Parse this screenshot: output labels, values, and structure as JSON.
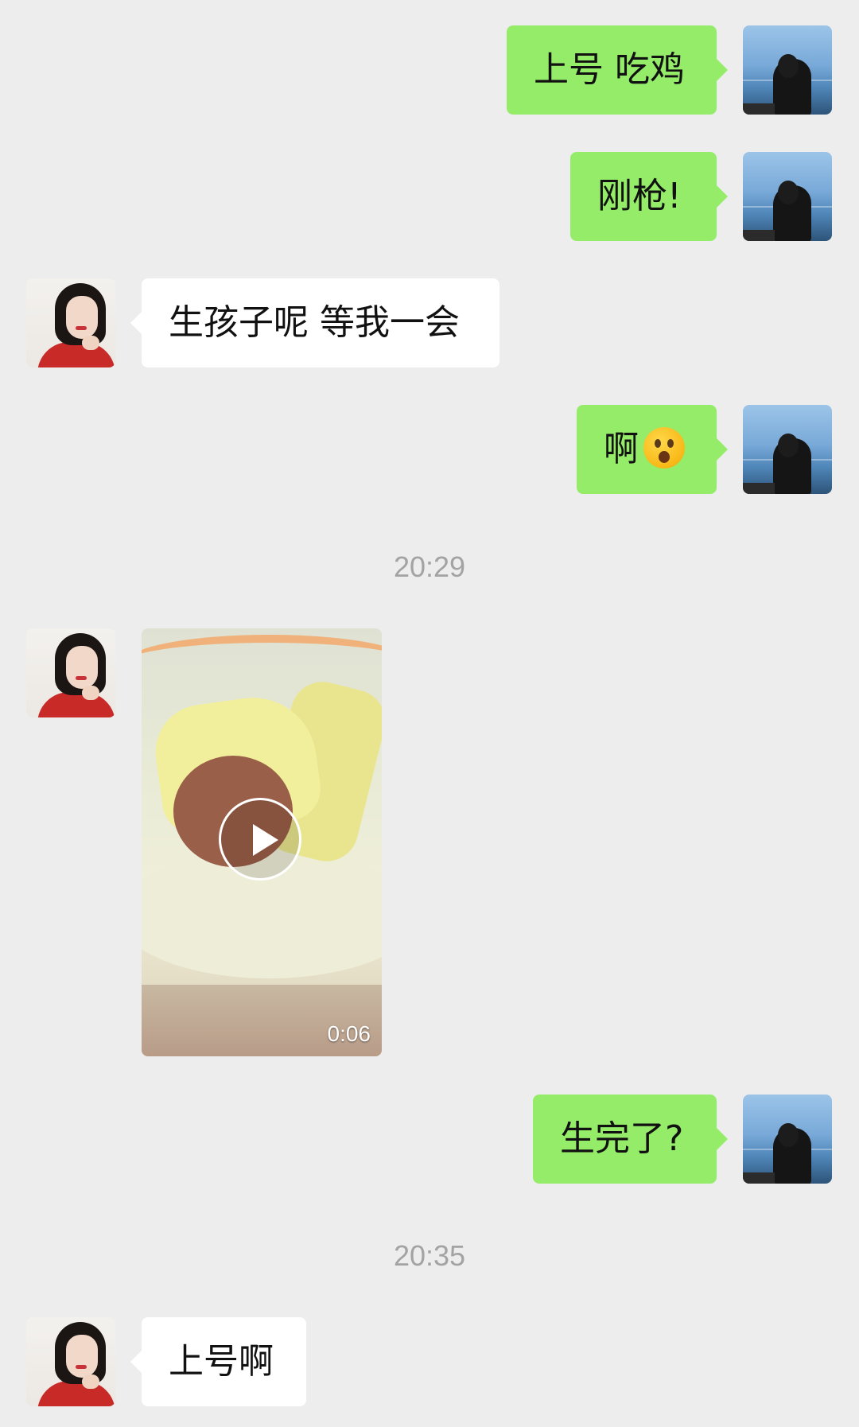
{
  "colors": {
    "background": "#ededed",
    "my_bubble": "#95ec69",
    "friend_bubble": "#ffffff",
    "timestamp_text": "#a3a3a3"
  },
  "messages": [
    {
      "sender": "me",
      "type": "text",
      "text": "上号 吃鸡"
    },
    {
      "sender": "me",
      "type": "text",
      "text": "刚枪!"
    },
    {
      "sender": "friend",
      "type": "text",
      "text": "生孩子呢 等我一会"
    },
    {
      "sender": "me",
      "type": "text",
      "text": "啊",
      "emoji": "astonished-face-emoji"
    },
    {
      "type": "timestamp",
      "text": "20:29"
    },
    {
      "sender": "friend",
      "type": "video",
      "duration": "0:06",
      "icon": "play-icon"
    },
    {
      "sender": "me",
      "type": "text",
      "text": "生完了?"
    },
    {
      "type": "timestamp",
      "text": "20:35"
    },
    {
      "sender": "friend",
      "type": "text",
      "text": "上号啊"
    }
  ]
}
